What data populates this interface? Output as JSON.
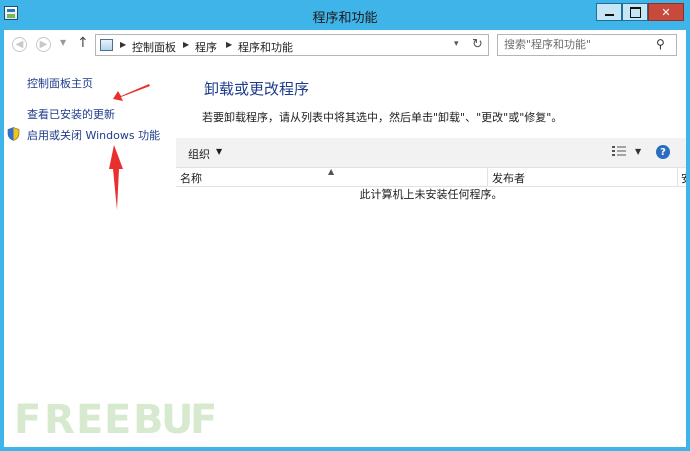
{
  "window": {
    "title": "程序和功能",
    "icon": "control-panel-window-icon",
    "controls": {
      "minimize": "minimize-icon",
      "maximize": "maximize-icon",
      "close": "✕"
    }
  },
  "navigation": {
    "back_icon": "back-arrow-icon",
    "forward_icon": "forward-arrow-icon",
    "up_icon": "up-arrow-icon",
    "address_icon": "control-panel-icon",
    "breadcrumbs": [
      "控制面板",
      "程序",
      "程序和功能"
    ],
    "refresh_icon": "refresh-icon",
    "search": {
      "placeholder": "搜索\"程序和功能\"",
      "value": ""
    }
  },
  "sidebar": {
    "items": [
      {
        "label": "控制面板主页",
        "icon": null
      },
      {
        "label": "查看已安装的更新",
        "icon": null
      },
      {
        "label": "启用或关闭 Windows 功能",
        "icon": "uac-shield-icon"
      }
    ]
  },
  "main": {
    "heading": "卸载或更改程序",
    "description": "若要卸载程序，请从列表中将其选中，然后单击\"卸载\"、\"更改\"或\"修复\"。",
    "toolbar": {
      "organize_label": "组织",
      "view_icon": "view-options-icon",
      "help_icon": "help-icon",
      "help_label": "?"
    },
    "columns": [
      "名称",
      "发布者",
      "安"
    ],
    "empty_message": "此计算机上未安装任何程序。"
  },
  "annotations": {
    "color": "#e8312f",
    "arrow_count": 2
  },
  "watermark": {
    "text": "FREEBUF",
    "color": "#d7ead0",
    "letters": [
      "F",
      "R",
      "E",
      "E",
      "B",
      "U",
      "F"
    ]
  },
  "colors": {
    "frame": "#3fb4e8",
    "link": "#1e3c8c",
    "close": "#c74a3c"
  }
}
